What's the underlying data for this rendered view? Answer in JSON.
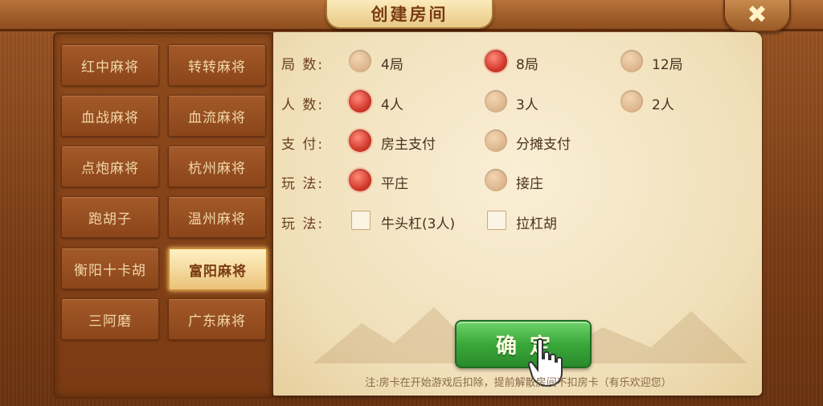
{
  "dialog": {
    "title": "创建房间",
    "close_label": "✖"
  },
  "sidebar": {
    "items": [
      {
        "label": "红中麻将",
        "selected": false
      },
      {
        "label": "转转麻将",
        "selected": false
      },
      {
        "label": "血战麻将",
        "selected": false
      },
      {
        "label": "血流麻将",
        "selected": false
      },
      {
        "label": "点炮麻将",
        "selected": false
      },
      {
        "label": "杭州麻将",
        "selected": false
      },
      {
        "label": "跑胡子",
        "selected": false
      },
      {
        "label": "温州麻将",
        "selected": false
      },
      {
        "label": "衡阳十卡胡",
        "selected": false
      },
      {
        "label": "富阳麻将",
        "selected": true
      },
      {
        "label": "三阿磨",
        "selected": false
      },
      {
        "label": "广东麻将",
        "selected": false
      }
    ]
  },
  "options": {
    "rounds": {
      "label": "局 数:",
      "choices": [
        "4局",
        "8局",
        "12局"
      ],
      "selected": "8局"
    },
    "players": {
      "label": "人 数:",
      "choices": [
        "4人",
        "3人",
        "2人"
      ],
      "selected": "4人"
    },
    "payment": {
      "label": "支 付:",
      "choices": [
        "房主支付",
        "分摊支付"
      ],
      "selected": "房主支付"
    },
    "play_mode": {
      "label": "玩 法:",
      "choices": [
        "平庄",
        "接庄"
      ],
      "selected": "平庄"
    },
    "extras": {
      "label": "玩 法:",
      "choices": [
        "牛头杠(3人)",
        "拉杠胡"
      ],
      "checked": []
    }
  },
  "confirm_label": "确定",
  "note": "注:房卡在开始游戏后扣除，提前解散房间不扣房卡（有乐欢迎您）",
  "colors": {
    "radio_on": "#d33a2c",
    "confirm_green": "#3aa83a",
    "paper": "#f5e6c4",
    "frame": "#8a4519"
  },
  "icons": {
    "close": "close-icon",
    "hand": "pointing-hand-icon"
  }
}
